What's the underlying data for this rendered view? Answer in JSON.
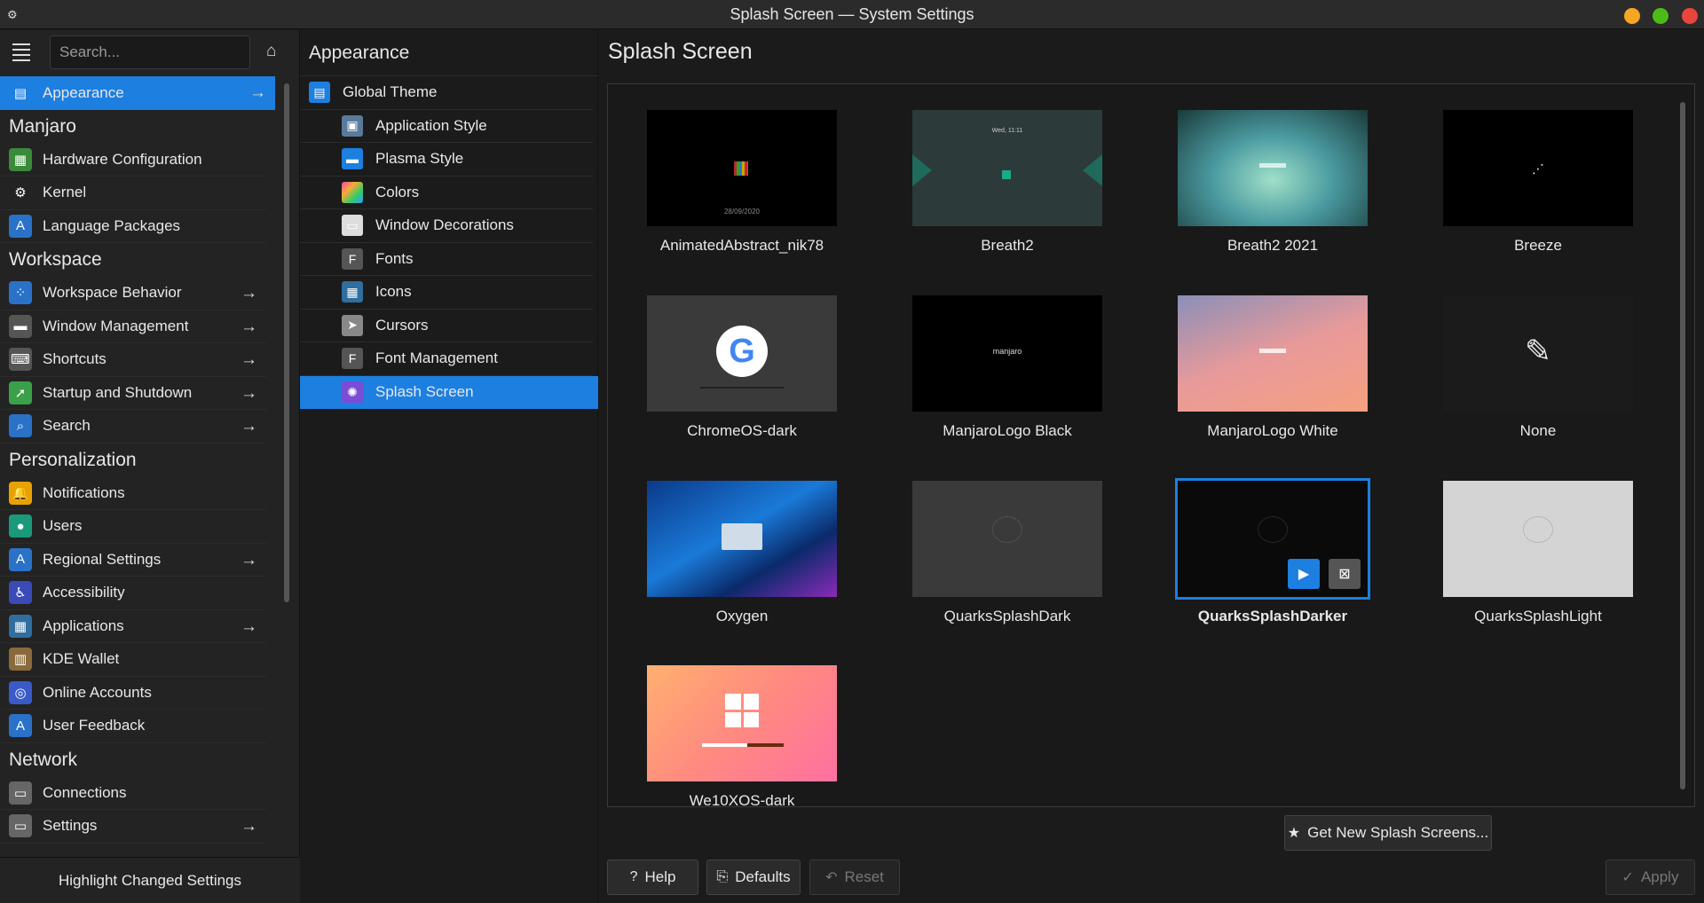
{
  "window": {
    "title": "Splash Screen — System Settings"
  },
  "sidebar": {
    "search_placeholder": "Search...",
    "active": "Appearance",
    "sections": [
      {
        "header": "",
        "items": [
          {
            "label": "Appearance",
            "icon": "appearance-icon",
            "arrow": true,
            "active": true
          }
        ]
      },
      {
        "header": "Manjaro",
        "items": [
          {
            "label": "Hardware Configuration",
            "icon": "hardware-icon",
            "arrow": false
          },
          {
            "label": "Kernel",
            "icon": "kernel-icon",
            "arrow": false
          },
          {
            "label": "Language Packages",
            "icon": "language-icon",
            "arrow": false
          }
        ]
      },
      {
        "header": "Workspace",
        "items": [
          {
            "label": "Workspace Behavior",
            "icon": "workspace-icon",
            "arrow": true
          },
          {
            "label": "Window Management",
            "icon": "window-management-icon",
            "arrow": true
          },
          {
            "label": "Shortcuts",
            "icon": "keyboard-icon",
            "arrow": true
          },
          {
            "label": "Startup and Shutdown",
            "icon": "rocket-icon",
            "arrow": true
          },
          {
            "label": "Search",
            "icon": "search-icon",
            "arrow": true
          }
        ]
      },
      {
        "header": "Personalization",
        "items": [
          {
            "label": "Notifications",
            "icon": "bell-icon",
            "arrow": false
          },
          {
            "label": "Users",
            "icon": "user-icon",
            "arrow": false
          },
          {
            "label": "Regional Settings",
            "icon": "regional-icon",
            "arrow": true
          },
          {
            "label": "Accessibility",
            "icon": "accessibility-icon",
            "arrow": false
          },
          {
            "label": "Applications",
            "icon": "applications-icon",
            "arrow": true
          },
          {
            "label": "KDE Wallet",
            "icon": "wallet-icon",
            "arrow": false
          },
          {
            "label": "Online Accounts",
            "icon": "online-accounts-icon",
            "arrow": false
          },
          {
            "label": "User Feedback",
            "icon": "feedback-icon",
            "arrow": false
          }
        ]
      },
      {
        "header": "Network",
        "items": [
          {
            "label": "Connections",
            "icon": "connections-icon",
            "arrow": false
          },
          {
            "label": "Settings",
            "icon": "network-settings-icon",
            "arrow": true
          }
        ]
      }
    ],
    "bottom_label": "Highlight Changed Settings"
  },
  "middle": {
    "title": "Appearance",
    "items": [
      {
        "label": "Global Theme",
        "icon": "global-theme-icon",
        "sub": false
      },
      {
        "label": "Application Style",
        "icon": "app-style-icon",
        "sub": true
      },
      {
        "label": "Plasma Style",
        "icon": "plasma-style-icon",
        "sub": true
      },
      {
        "label": "Colors",
        "icon": "colors-icon",
        "sub": true
      },
      {
        "label": "Window Decorations",
        "icon": "window-decorations-icon",
        "sub": true
      },
      {
        "label": "Fonts",
        "icon": "fonts-icon",
        "sub": true
      },
      {
        "label": "Icons",
        "icon": "icons-icon",
        "sub": true
      },
      {
        "label": "Cursors",
        "icon": "cursor-icon",
        "sub": true
      },
      {
        "label": "Font Management",
        "icon": "font-management-icon",
        "sub": true
      },
      {
        "label": "Splash Screen",
        "icon": "splash-icon",
        "sub": true,
        "active": true
      }
    ]
  },
  "main": {
    "title": "Splash Screen",
    "themes": [
      {
        "name": "AnimatedAbstract_nik78",
        "thumb_style": "abstract"
      },
      {
        "name": "Breath2",
        "thumb_style": "breath2"
      },
      {
        "name": "Breath2 2021",
        "thumb_style": "breath2021"
      },
      {
        "name": "Breeze",
        "thumb_style": "breeze"
      },
      {
        "name": "ChromeOS-dark",
        "thumb_style": "chromeos"
      },
      {
        "name": "ManjaroLogo Black",
        "thumb_style": "manjaro-black"
      },
      {
        "name": "ManjaroLogo White",
        "thumb_style": "manjaro-white"
      },
      {
        "name": "None",
        "thumb_style": "none"
      },
      {
        "name": "Oxygen",
        "thumb_style": "oxygen"
      },
      {
        "name": "QuarksSplashDark",
        "thumb_style": "quarks-dark"
      },
      {
        "name": "QuarksSplashDarker",
        "thumb_style": "quarks-darker",
        "selected": true
      },
      {
        "name": "QuarksSplashLight",
        "thumb_style": "quarks-light"
      },
      {
        "name": "We10XOS-dark",
        "thumb_style": "we10x"
      }
    ],
    "thumb_text": {
      "abstract_date": "28/09/2020",
      "breath2_time": "Wed, 11:11",
      "manjaro_logo": "manjaro"
    },
    "get_new_label": "Get New Splash Screens...",
    "help_label": "Help",
    "defaults_label": "Defaults",
    "reset_label": "Reset",
    "apply_label": "Apply"
  },
  "colors": {
    "accent": "#1d7fe0",
    "background": "#1b1b1b",
    "sidebar": "#232323"
  }
}
